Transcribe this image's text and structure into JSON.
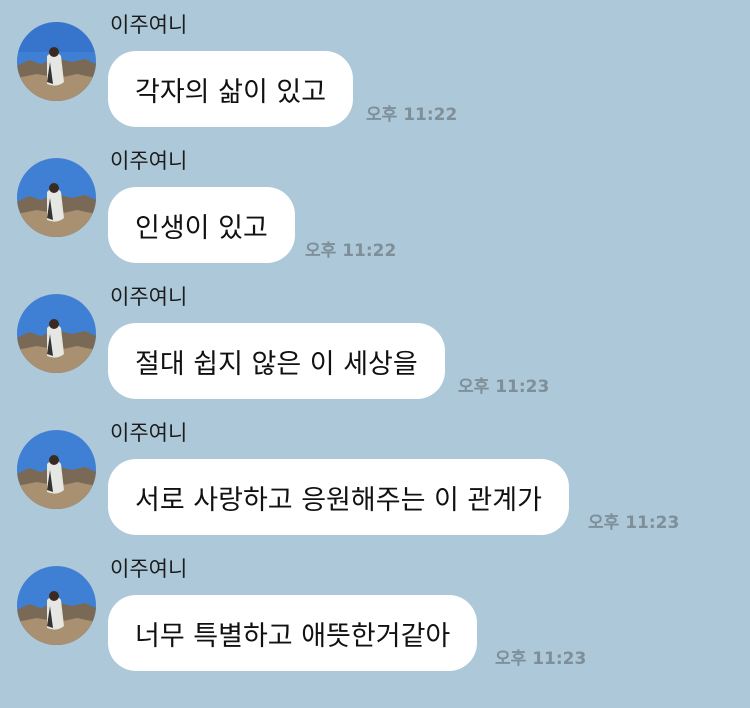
{
  "messages": [
    {
      "sender": "이주여니",
      "text": "각자의 삶이 있고",
      "time": "오후 11:22"
    },
    {
      "sender": "이주여니",
      "text": "인생이 있고",
      "time": "오후 11:22"
    },
    {
      "sender": "이주여니",
      "text": "절대 쉽지 않은 이 세상을",
      "time": "오후 11:23"
    },
    {
      "sender": "이주여니",
      "text": "서로 사랑하고 응원해주는 이 관계가",
      "time": "오후 11:23"
    },
    {
      "sender": "이주여니",
      "text": "너무 특별하고 애뜻한거같아",
      "time": "오후 11:23"
    }
  ],
  "colors": {
    "background": "#adc8d8",
    "bubble": "#ffffff",
    "time_text": "#7f8f99"
  },
  "icons": {
    "avatar": "profile-photo-person-on-hill"
  }
}
